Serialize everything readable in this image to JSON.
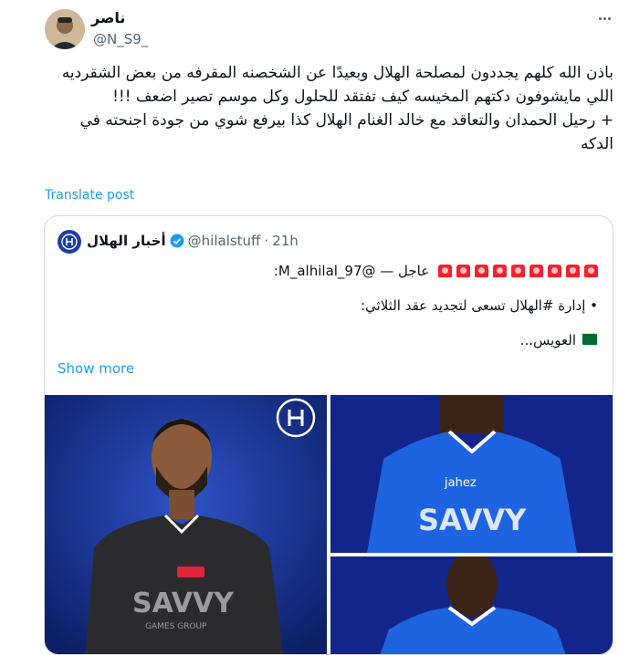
{
  "author": {
    "display_name": "ناصر",
    "handle": "@N_S9_"
  },
  "tweet": {
    "paragraph_1": "باذن الله كلهم يجددون لمصلحة الهلال وبعيدًا عن الشخصنه المقرفه من بعض الشقرديه اللي مايشوفون دكتهم المخيسه كيف تفتقد للحلول وكل موسم تصير اضعف !!!",
    "paragraph_2": "+ رحيل الحمدان والتعاقد مع خالد الغنام الهلال كذا بيرفع شوي من جودة اجنحته في الدكه",
    "translate_label": "Translate post"
  },
  "quoted": {
    "display_name": "أخبار الهلال",
    "handle": "@hilalstuff",
    "separator": "·",
    "time": "21h",
    "line_1": "عاجل — @M_alhilal_97:",
    "line_2": "• إدارة #الهلال تسعى لتجديد عقد الثلاثي:",
    "line_3": "العويس...",
    "show_more_label": "Show more"
  },
  "media": {
    "jersey_sponsor": "SAVVY",
    "jersey_sponsor_sub": "GAMES GROUP",
    "jersey_partner": "jahez"
  },
  "colors": {
    "accent": "#1d9bf0",
    "hilal_blue": "#1a3fa6"
  }
}
